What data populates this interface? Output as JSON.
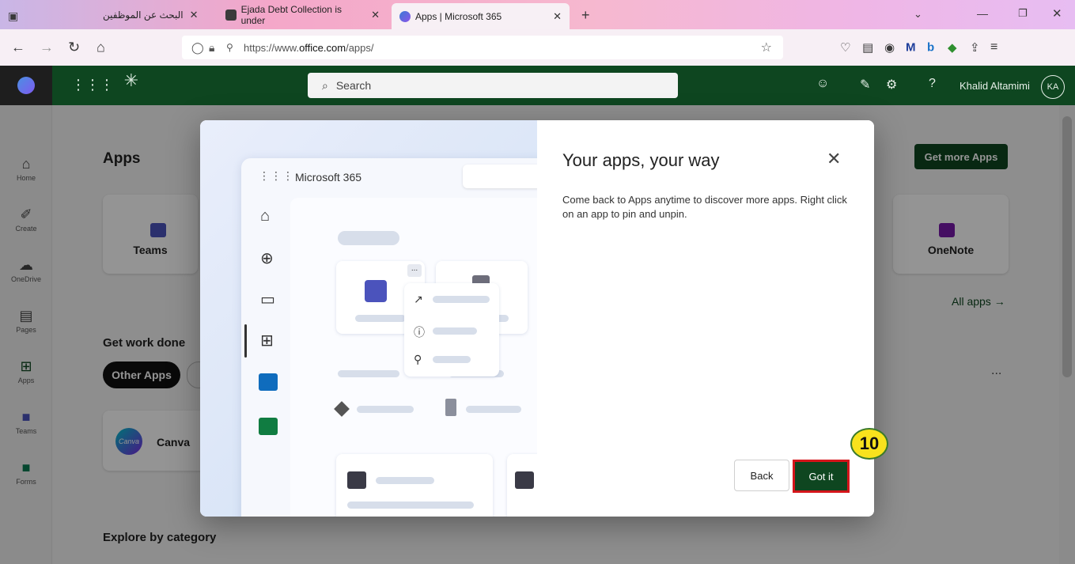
{
  "browser": {
    "tabs": [
      {
        "title": "البحث عن الموظفين",
        "active": false
      },
      {
        "title": "Ejada Debt Collection is under",
        "active": false
      },
      {
        "title": "Apps | Microsoft 365",
        "active": true
      }
    ],
    "url_prefix": "https://www.",
    "url_domain": "office.com",
    "url_suffix": "/apps/"
  },
  "header": {
    "search_placeholder": "Search",
    "user_name": "Khalid Altamimi",
    "user_initials": "KA"
  },
  "rail": [
    {
      "label": "Home",
      "icon": "home-icon"
    },
    {
      "label": "Create",
      "icon": "pen-icon"
    },
    {
      "label": "OneDrive",
      "icon": "cloud-icon"
    },
    {
      "label": "Pages",
      "icon": "page-icon"
    },
    {
      "label": "Apps",
      "icon": "apps-icon"
    },
    {
      "label": "Teams",
      "icon": "teams-icon"
    },
    {
      "label": "Forms",
      "icon": "forms-icon"
    }
  ],
  "main": {
    "apps_heading": "Apps",
    "get_more_label": "Get more Apps",
    "app_cards": [
      {
        "label": "Teams"
      },
      {
        "label": "OneNote"
      }
    ],
    "all_apps_label": "All apps →",
    "work_heading": "Get work done",
    "other_apps_pill": "Other Apps",
    "canva_label": "Canva",
    "canva_logo_text": "Canva",
    "more_dots": "...",
    "explore_heading": "Explore by category"
  },
  "dialog": {
    "title": "Your apps, your way",
    "body": "Come back to Apps anytime to discover more apps. Right click on an app to pin and unpin.",
    "back_label": "Back",
    "got_it_label": "Got it",
    "illustration_title": "Microsoft 365",
    "illustration_dots": "..."
  },
  "step_badge": "10",
  "colors": {
    "office_green": "#0e4620",
    "highlight_red": "#d4151b",
    "badge_yellow": "#f8e21d"
  }
}
